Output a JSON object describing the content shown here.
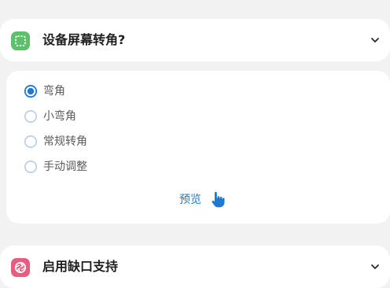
{
  "sections": [
    {
      "title": "设备屏幕转角?",
      "icon": "rounded-square-icon",
      "icon_color": "#5cc16a"
    },
    {
      "title": "启用缺口支持",
      "icon": "aperture-icon",
      "icon_color": "#ea5b80"
    }
  ],
  "corner_options": [
    {
      "label": "弯角",
      "selected": true
    },
    {
      "label": "小弯角",
      "selected": false
    },
    {
      "label": "常规转角",
      "selected": false
    },
    {
      "label": "手动调整",
      "selected": false
    }
  ],
  "preview": {
    "label": "预览",
    "icon": "hand-pointer-icon"
  },
  "colors": {
    "accent": "#1f78d4",
    "radio_border": "#b8cce6",
    "background": "#f2f2f2",
    "card": "#ffffff"
  }
}
